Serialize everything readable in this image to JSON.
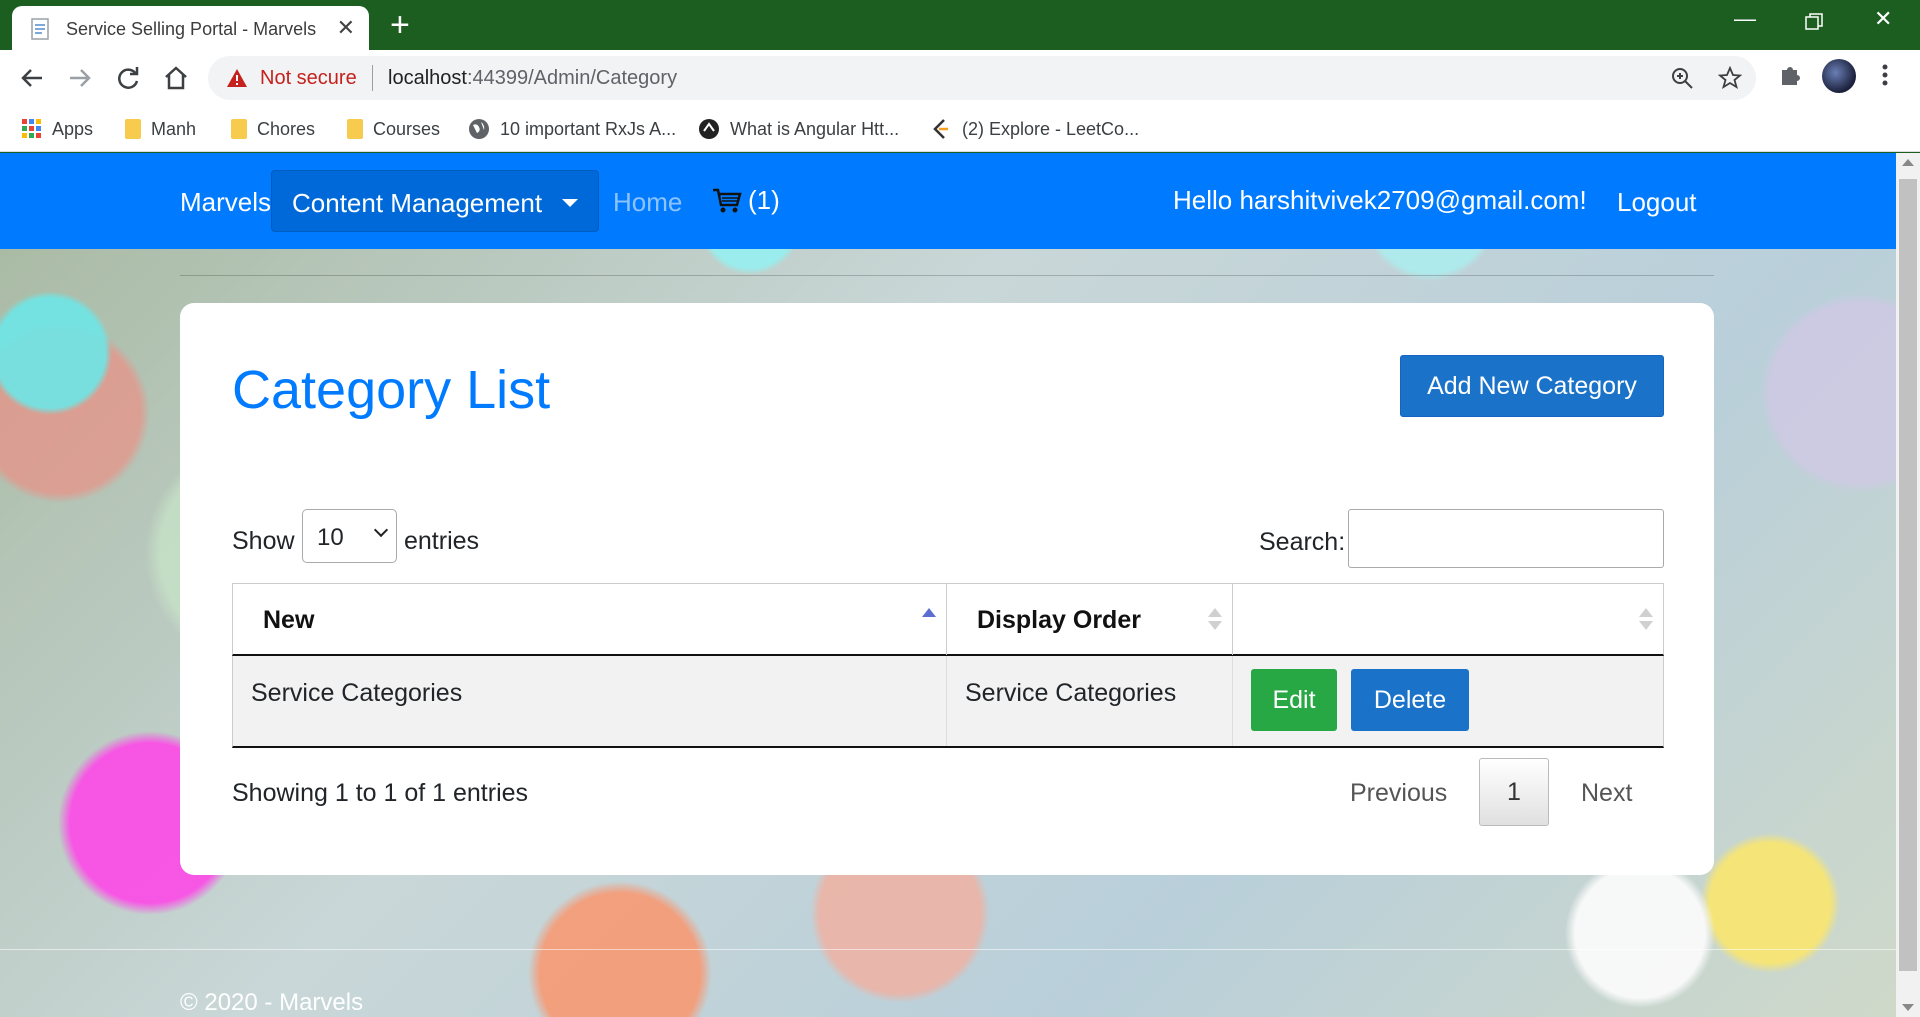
{
  "browser": {
    "tab_title": "Service Selling Portal - Marvels",
    "not_secure": "Not secure",
    "url_host": "localhost",
    "url_rest": ":44399/Admin/Category",
    "bookmarks": [
      {
        "label": "Apps",
        "icon": "apps-grid-icon"
      },
      {
        "label": "Manh",
        "icon": "folder-icon"
      },
      {
        "label": "Chores",
        "icon": "folder-icon"
      },
      {
        "label": "Courses",
        "icon": "folder-icon"
      },
      {
        "label": "10 important RxJs A...",
        "icon": "globe-icon"
      },
      {
        "label": "What is Angular Htt...",
        "icon": "site-icon"
      },
      {
        "label": "(2) Explore - LeetCo...",
        "icon": "leetcode-icon"
      }
    ]
  },
  "navbar": {
    "brand": "Marvels",
    "content_management": "Content Management",
    "home": "Home",
    "cart_count": "(1)",
    "hello": "Hello harshitvivek2709@gmail.com!",
    "logout": "Logout",
    "color": "#007bff"
  },
  "card": {
    "title": "Category List",
    "add_button": "Add New Category",
    "show_label": "Show",
    "page_length": "10",
    "entries_label": "entries",
    "search_label": "Search:",
    "search_value": ""
  },
  "table": {
    "columns": [
      "New",
      "Display Order",
      ""
    ],
    "rows": [
      {
        "name": "Service Categories",
        "display_order": "Service Categories",
        "edit": "Edit",
        "delete": "Delete"
      }
    ]
  },
  "pagination": {
    "info": "Showing 1 to 1 of 1 entries",
    "previous": "Previous",
    "current_page": "1",
    "next": "Next"
  },
  "footer": {
    "text": "© 2020 - Marvels"
  }
}
